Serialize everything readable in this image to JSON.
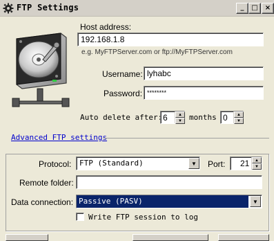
{
  "window": {
    "title": "FTP Settings",
    "icon": "gear-icon",
    "controls": {
      "minimize": "_",
      "maximize": "□",
      "close": "×"
    }
  },
  "host": {
    "label": "Host address:",
    "value": "192.168.1.8",
    "example": "e.g. MyFTPServer.com or ftp://MyFTPServer.com"
  },
  "username": {
    "label": "Username:",
    "value": "lyhabc"
  },
  "password": {
    "label": "Password:",
    "value": "********"
  },
  "auto_delete": {
    "label": "Auto delete after:",
    "value": "6",
    "unit": "months",
    "extra_value": "0"
  },
  "advanced_link": "Advanced FTP settings",
  "protocol": {
    "label": "Protocol:",
    "value": "FTP (Standard)"
  },
  "port": {
    "label": "Port:",
    "value": "21"
  },
  "remote_folder": {
    "label": "Remote folder:",
    "value": ""
  },
  "data_connection": {
    "label": "Data connection:",
    "value": "Passive (PASV)"
  },
  "write_log": {
    "label": "Write FTP session to log",
    "checked": false
  },
  "colors": {
    "selection": "#0a246a",
    "link": "#0000cc",
    "face": "#ece9d8"
  }
}
